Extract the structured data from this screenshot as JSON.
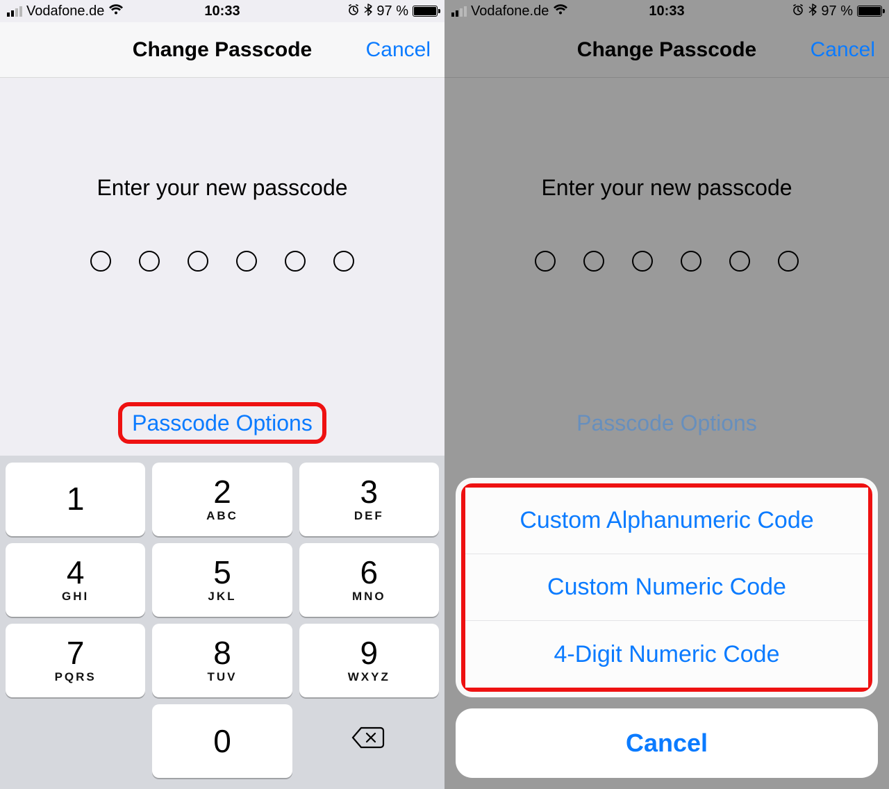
{
  "status": {
    "carrier": "Vodafone.de",
    "time": "10:33",
    "battery_pct": "97 %"
  },
  "nav": {
    "title": "Change Passcode",
    "cancel": "Cancel"
  },
  "prompt": "Enter your new passcode",
  "options_link": "Passcode Options",
  "keypad": {
    "keys": [
      {
        "digit": "1",
        "letters": ""
      },
      {
        "digit": "2",
        "letters": "ABC"
      },
      {
        "digit": "3",
        "letters": "DEF"
      },
      {
        "digit": "4",
        "letters": "GHI"
      },
      {
        "digit": "5",
        "letters": "JKL"
      },
      {
        "digit": "6",
        "letters": "MNO"
      },
      {
        "digit": "7",
        "letters": "PQRS"
      },
      {
        "digit": "8",
        "letters": "TUV"
      },
      {
        "digit": "9",
        "letters": "WXYZ"
      },
      {
        "digit": "0",
        "letters": ""
      }
    ]
  },
  "sheet": {
    "items": [
      "Custom Alphanumeric Code",
      "Custom Numeric Code",
      "4-Digit Numeric Code"
    ],
    "cancel": "Cancel"
  },
  "colors": {
    "accent": "#0b7bff",
    "highlight_border": "#e11"
  }
}
